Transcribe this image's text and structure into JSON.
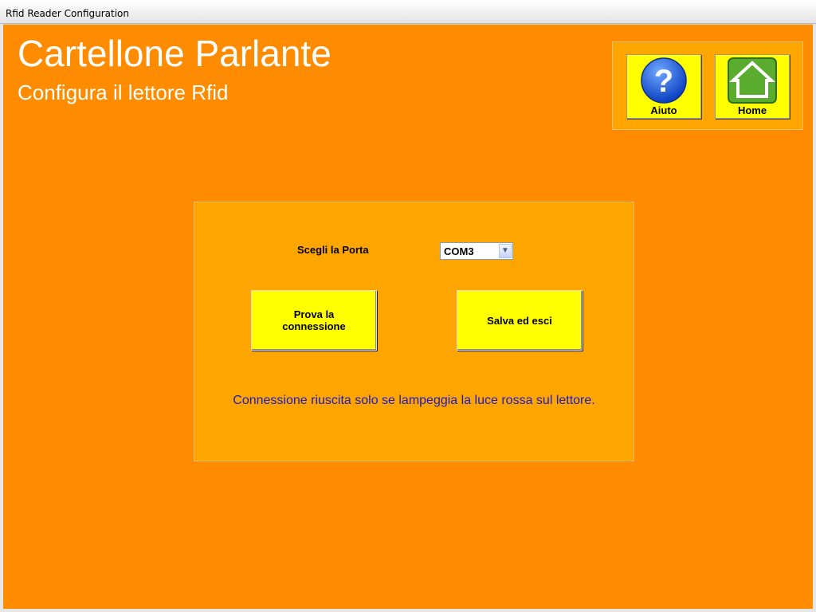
{
  "window": {
    "title": "Rfid Reader Configuration"
  },
  "header": {
    "title": "Cartellone Parlante",
    "subtitle": "Configura il lettore Rfid"
  },
  "nav": {
    "help": {
      "label": "Aiuto",
      "icon": "question-icon"
    },
    "home": {
      "label": "Home",
      "icon": "home-icon"
    }
  },
  "form": {
    "port_label": "Scegli la Porta",
    "port_value": "COM3",
    "test_button": "Prova la connessione",
    "save_button": "Salva ed esci",
    "note": "Connessione riuscita solo se lampeggia la luce rossa sul lettore."
  },
  "colors": {
    "background": "#ff8c00",
    "panel": "#ffa500",
    "button": "#ffff00",
    "note_text": "#1a1ad0"
  }
}
